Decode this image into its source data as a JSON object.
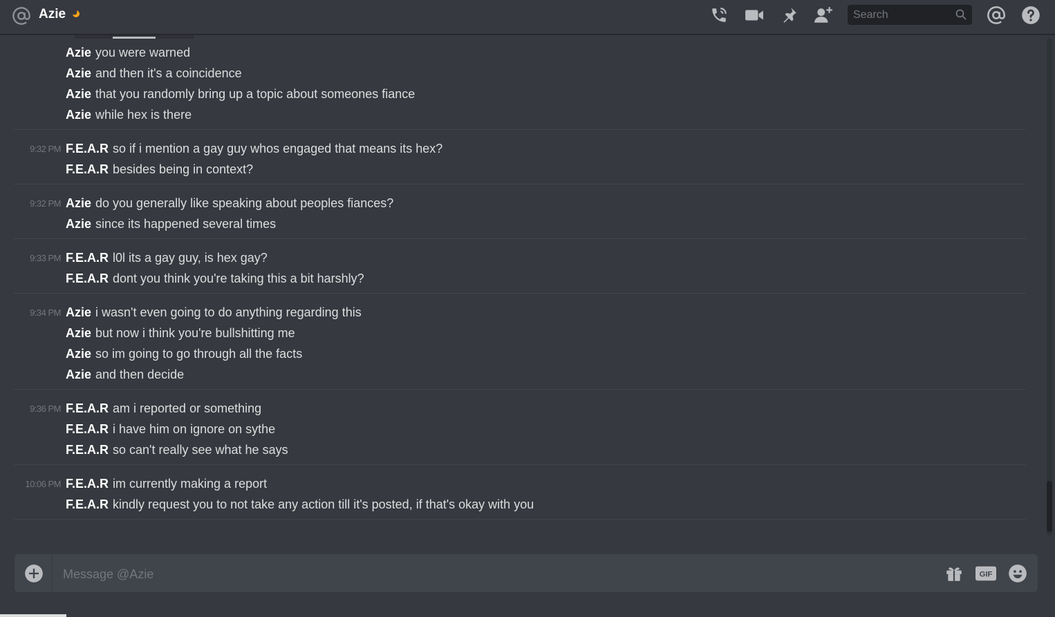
{
  "header": {
    "title": "Azie",
    "icons": [
      "at-icon",
      "moon-status-icon",
      "phone-call-icon",
      "video-call-icon",
      "pin-icon",
      "add-friend-icon",
      "search-icon",
      "mentions-icon",
      "help-icon"
    ],
    "search_placeholder": "Search"
  },
  "messages": [
    {
      "timestamp": "",
      "lines": [
        {
          "author": "Azie",
          "text": "you were warned"
        },
        {
          "author": "Azie",
          "text": "and then it's a coincidence"
        },
        {
          "author": "Azie",
          "text": "that you randomly bring up a topic about someones fiance"
        },
        {
          "author": "Azie",
          "text": "while hex is there"
        }
      ]
    },
    {
      "timestamp": "9:32 PM",
      "lines": [
        {
          "author": "F.E.A.R",
          "text": "so if i mention a gay guy whos engaged that means its hex?"
        },
        {
          "author": "F.E.A.R",
          "text": "besides being in context?"
        }
      ]
    },
    {
      "timestamp": "9:32 PM",
      "lines": [
        {
          "author": "Azie",
          "text": "do you generally like speaking about peoples fiances?"
        },
        {
          "author": "Azie",
          "text": "since its happened several times"
        }
      ]
    },
    {
      "timestamp": "9:33 PM",
      "lines": [
        {
          "author": "F.E.A.R",
          "text": "l0l its a gay guy, is hex gay?"
        },
        {
          "author": "F.E.A.R",
          "text": "dont you think you're taking this a bit harshly?"
        }
      ]
    },
    {
      "timestamp": "9:34 PM",
      "lines": [
        {
          "author": "Azie",
          "text": "i wasn't even going to do anything regarding this"
        },
        {
          "author": "Azie",
          "text": "but now i think you're bullshitting me"
        },
        {
          "author": "Azie",
          "text": "so im going to go through all the facts"
        },
        {
          "author": "Azie",
          "text": "and then decide"
        }
      ]
    },
    {
      "timestamp": "9:36 PM",
      "lines": [
        {
          "author": "F.E.A.R",
          "text": "am i reported or something"
        },
        {
          "author": "F.E.A.R",
          "text": "i have him on ignore on sythe"
        },
        {
          "author": "F.E.A.R",
          "text": "so can't really see what he says"
        }
      ]
    },
    {
      "timestamp": "10:06 PM",
      "lines": [
        {
          "author": "F.E.A.R",
          "text": "im currently making a report"
        },
        {
          "author": "F.E.A.R",
          "text": "kindly request you to not take any action till it's posted, if that's okay with you"
        }
      ]
    }
  ],
  "composer": {
    "placeholder": "Message @Azie",
    "icons": [
      "add-attachment-icon",
      "gift-icon",
      "gif-icon",
      "emoji-icon"
    ],
    "gif_label": "GIF"
  },
  "colors": {
    "background": "#36393f",
    "author": "#ffffff",
    "text": "#dcddde",
    "timestamp": "#72767d",
    "idle_status": "#faa61a"
  }
}
